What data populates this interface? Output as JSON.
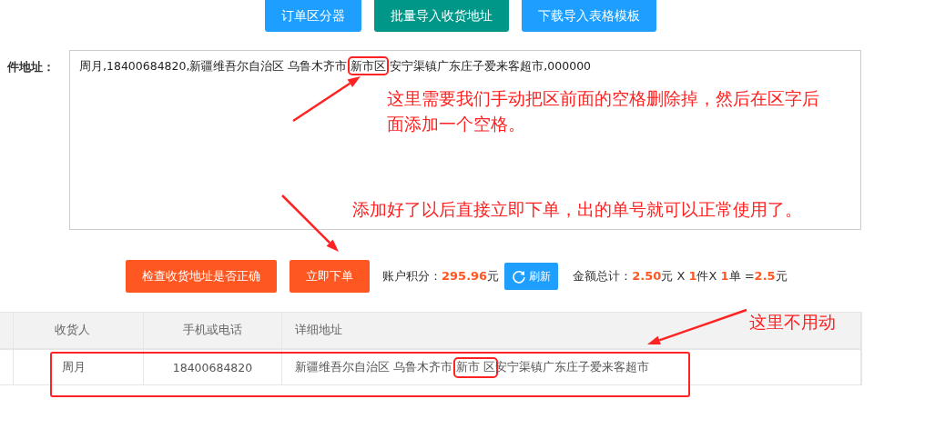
{
  "top_buttons": [
    {
      "label": "订单区分器",
      "kind": "blue"
    },
    {
      "label": "批量导入收货地址",
      "kind": "teal"
    },
    {
      "label": "下载导入表格模板",
      "kind": "blue"
    }
  ],
  "address_field": {
    "label": "件地址：",
    "value": "周月,18400684820,新疆维吾尔自治区 乌鲁木齐市 *新市区* 安宁渠镇广东庄子爱来客超市,000000"
  },
  "actions": [
    {
      "label": "检查收货地址是否正确"
    },
    {
      "label": "立即下单"
    }
  ],
  "points": "账户积分：**295.96**元",
  "refresh_button": "刷新",
  "total": "金额总计：**2.50**元 X **1**件X **1**单 =**2.5**元",
  "table": {
    "columns": [
      "收货人",
      "手机或电话",
      "详细地址"
    ],
    "rows": [
      {
        "name": "周月",
        "phone": "18400684820",
        "address": {
          "before": "新疆维吾尔自治区 乌鲁木齐市 ",
          "highlighted": "新市 区",
          "after": "安宁渠镇广东庄子爱来客超市"
        }
      }
    ]
  },
  "annotations": [
    {
      "text": "这里需要我们手动把区前面的空格删除掉，然后在区字后面添加一个空格。"
    },
    {
      "text": "添加好了以后直接立即下单，出的单号就可以正常使用了。"
    },
    {
      "text": "这里不用动"
    }
  ]
}
